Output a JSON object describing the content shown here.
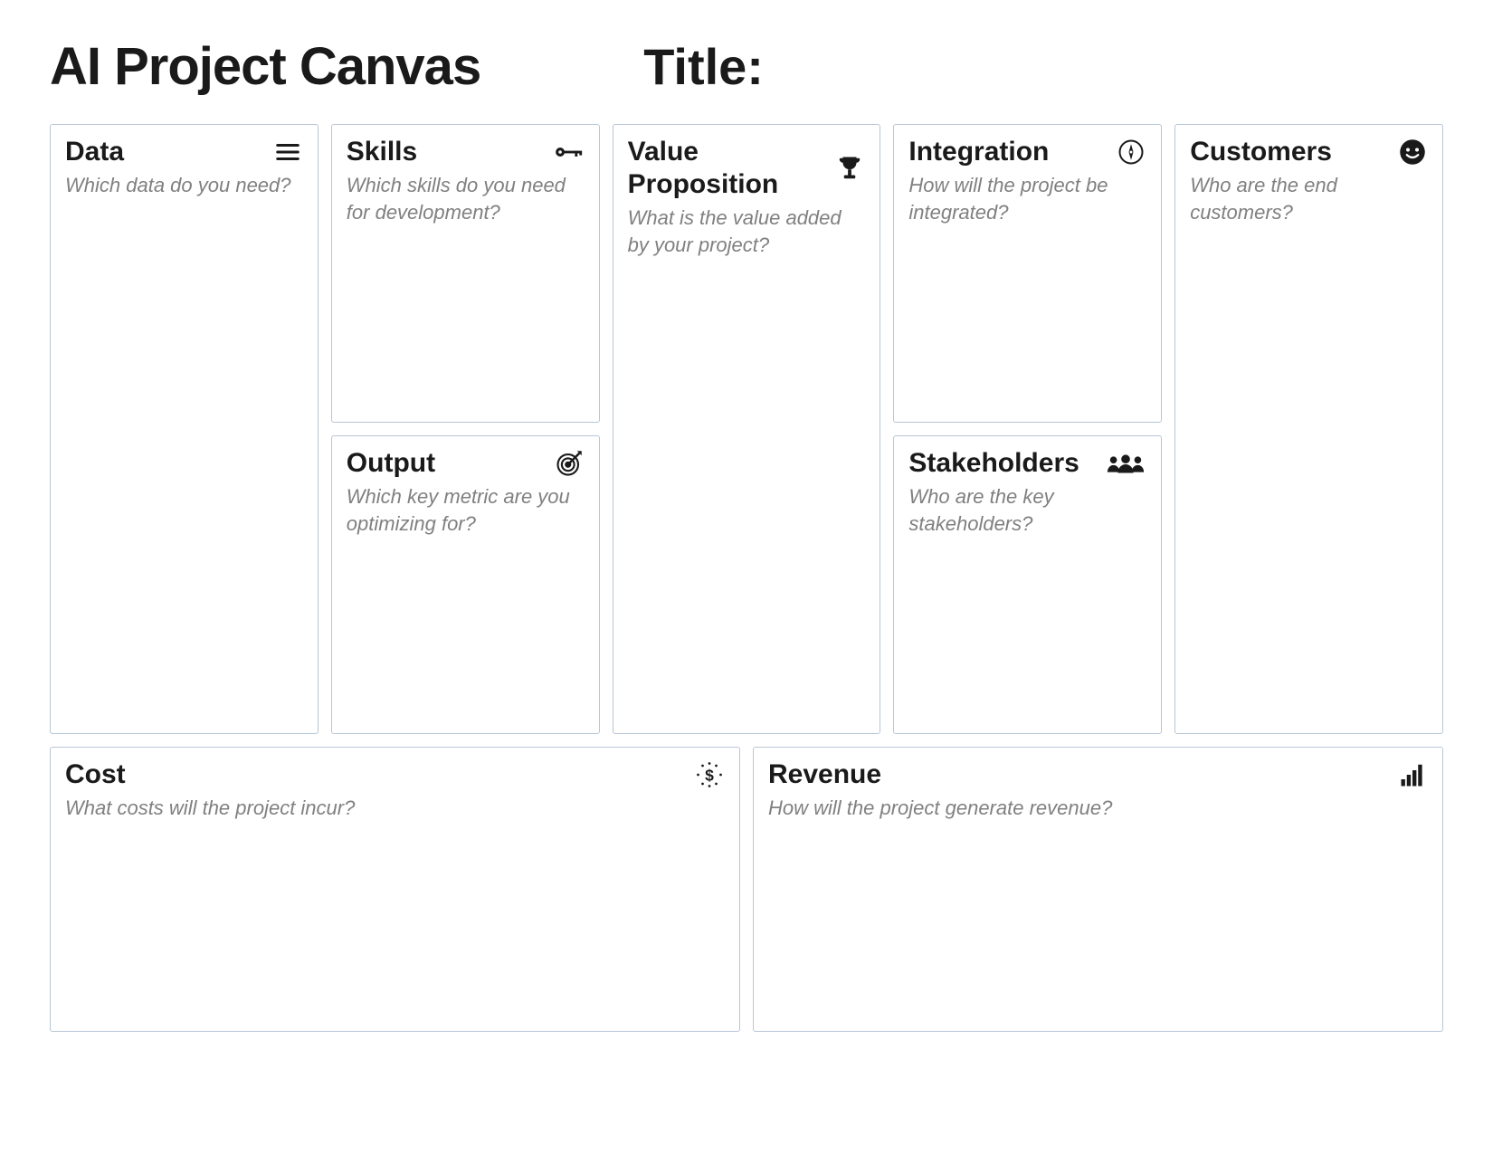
{
  "header": {
    "main_title": "AI Project Canvas",
    "title_label": "Title:"
  },
  "sections": {
    "data": {
      "title": "Data",
      "prompt": "Which data do you need?",
      "icon": "list-icon"
    },
    "skills": {
      "title": "Skills",
      "prompt": "Which skills do you need for development?",
      "icon": "key-icon"
    },
    "output": {
      "title": "Output",
      "prompt": "Which key metric are you optimizing for?",
      "icon": "target-icon"
    },
    "value": {
      "title": "Value Proposition",
      "prompt": "What is the value added by your project?",
      "icon": "trophy-icon"
    },
    "integration": {
      "title": "Integration",
      "prompt": "How will the project be integrated?",
      "icon": "compass-icon"
    },
    "stakeholders": {
      "title": "Stakeholders",
      "prompt": "Who are the key stakeholders?",
      "icon": "group-icon"
    },
    "customers": {
      "title": "Customers",
      "prompt": "Who are the end customers?",
      "icon": "smiley-icon"
    },
    "cost": {
      "title": "Cost",
      "prompt": "What costs will the project incur?",
      "icon": "dollar-icon"
    },
    "revenue": {
      "title": "Revenue",
      "prompt": "How will the project generate revenue?",
      "icon": "bars-icon"
    }
  }
}
